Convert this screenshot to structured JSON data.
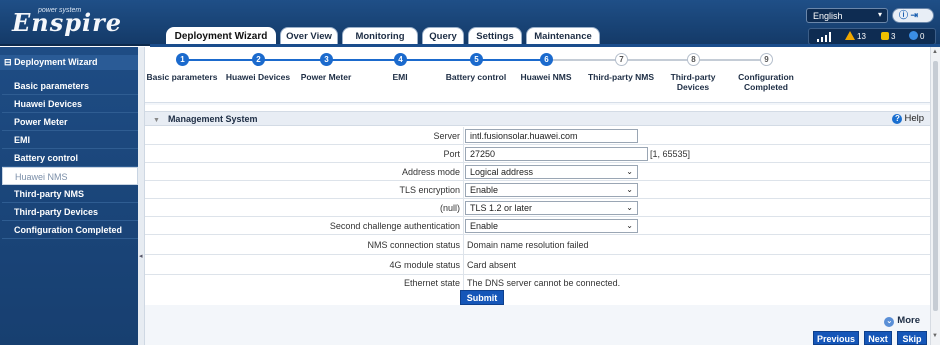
{
  "header": {
    "logo_text": "Enspire",
    "logo_tagline": "power system",
    "language": "English",
    "nav_tabs": [
      "Deployment Wizard",
      "Over View",
      "Monitoring",
      "Query",
      "Settings",
      "Maintenance"
    ],
    "alarms": {
      "major": "13",
      "minor": "3",
      "info": "0"
    }
  },
  "sidebar": {
    "title": "Deployment Wizard",
    "items": [
      "Basic parameters",
      "Huawei Devices",
      "Power Meter",
      "EMI",
      "Battery control",
      "Huawei NMS",
      "Third-party NMS",
      "Third-party Devices",
      "Configuration Completed"
    ],
    "active_index": 5
  },
  "wizard": {
    "steps": [
      {
        "num": "1",
        "label": "Basic parameters",
        "done": true
      },
      {
        "num": "2",
        "label": "Huawei Devices",
        "done": true
      },
      {
        "num": "3",
        "label": "Power Meter",
        "done": true
      },
      {
        "num": "4",
        "label": "EMI",
        "done": true
      },
      {
        "num": "5",
        "label": "Battery control",
        "done": true
      },
      {
        "num": "6",
        "label": "Huawei NMS",
        "done": true
      },
      {
        "num": "7",
        "label": "Third-party NMS",
        "done": false
      },
      {
        "num": "8",
        "label": "Third-party Devices",
        "done": false
      },
      {
        "num": "9",
        "label": "Configuration Completed",
        "done": false
      }
    ]
  },
  "panel": {
    "title": "Management System",
    "help": "Help",
    "fields": {
      "server": {
        "label": "Server",
        "value": "intl.fusionsolar.huawei.com"
      },
      "port": {
        "label": "Port",
        "value": "27250",
        "range": "[1, 65535]"
      },
      "address_mode": {
        "label": "Address mode",
        "value": "Logical address"
      },
      "tls": {
        "label": "TLS encryption",
        "value": "Enable"
      },
      "null_field": {
        "label": "(null)",
        "value": "TLS 1.2 or later"
      },
      "second_auth": {
        "label": "Second challenge authentication",
        "value": "Enable"
      },
      "nms_status": {
        "label": "NMS connection status",
        "value": "Domain name resolution failed"
      },
      "module_4g": {
        "label": "4G module status",
        "value": "Card absent"
      },
      "ethernet": {
        "label": "Ethernet state",
        "value": "The DNS server cannot be connected."
      }
    },
    "submit": "Submit"
  },
  "footer": {
    "more": "More",
    "previous": "Previous",
    "next": "Next",
    "skip": "Skip"
  }
}
